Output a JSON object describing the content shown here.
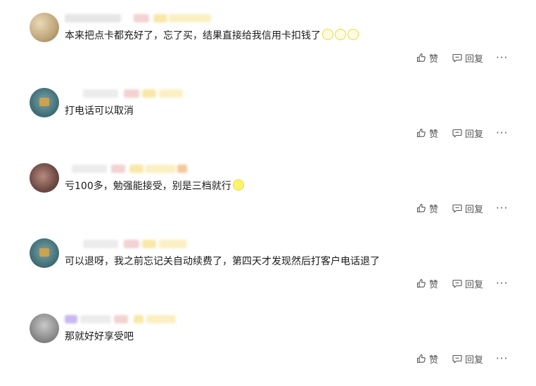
{
  "comments": [
    {
      "text": "本来把点卡都充好了，忘了买，结果直接给我信用卡扣钱了",
      "like_label": "赞",
      "reply_label": "回复",
      "more_label": "···",
      "avatar": "tan",
      "emoji_count": 3
    },
    {
      "text": "打电话可以取消",
      "like_label": "赞",
      "reply_label": "回复",
      "more_label": "···",
      "avatar": "teal",
      "emoji_count": 0
    },
    {
      "text": "亏100多，勉强能接受，别是三档就行",
      "like_label": "赞",
      "reply_label": "回复",
      "more_label": "···",
      "avatar": "brown",
      "emoji_count": 1
    },
    {
      "text": "可以退呀，我之前忘记关自动续费了，第四天才发现然后打客户电话退了",
      "like_label": "赞",
      "reply_label": "回复",
      "more_label": "···",
      "avatar": "teal",
      "emoji_count": 0
    },
    {
      "text": "那就好好享受吧",
      "like_label": "赞",
      "reply_label": "回复",
      "more_label": "···",
      "avatar": "gray",
      "emoji_count": 0
    }
  ],
  "colors": {
    "text": "#1a1a1a",
    "action": "#555555",
    "emoji_fill": "#fff46a"
  },
  "icons": {
    "like": "thumbs-up-icon",
    "reply": "comment-bubble-icon",
    "more": "more-dots-icon"
  }
}
